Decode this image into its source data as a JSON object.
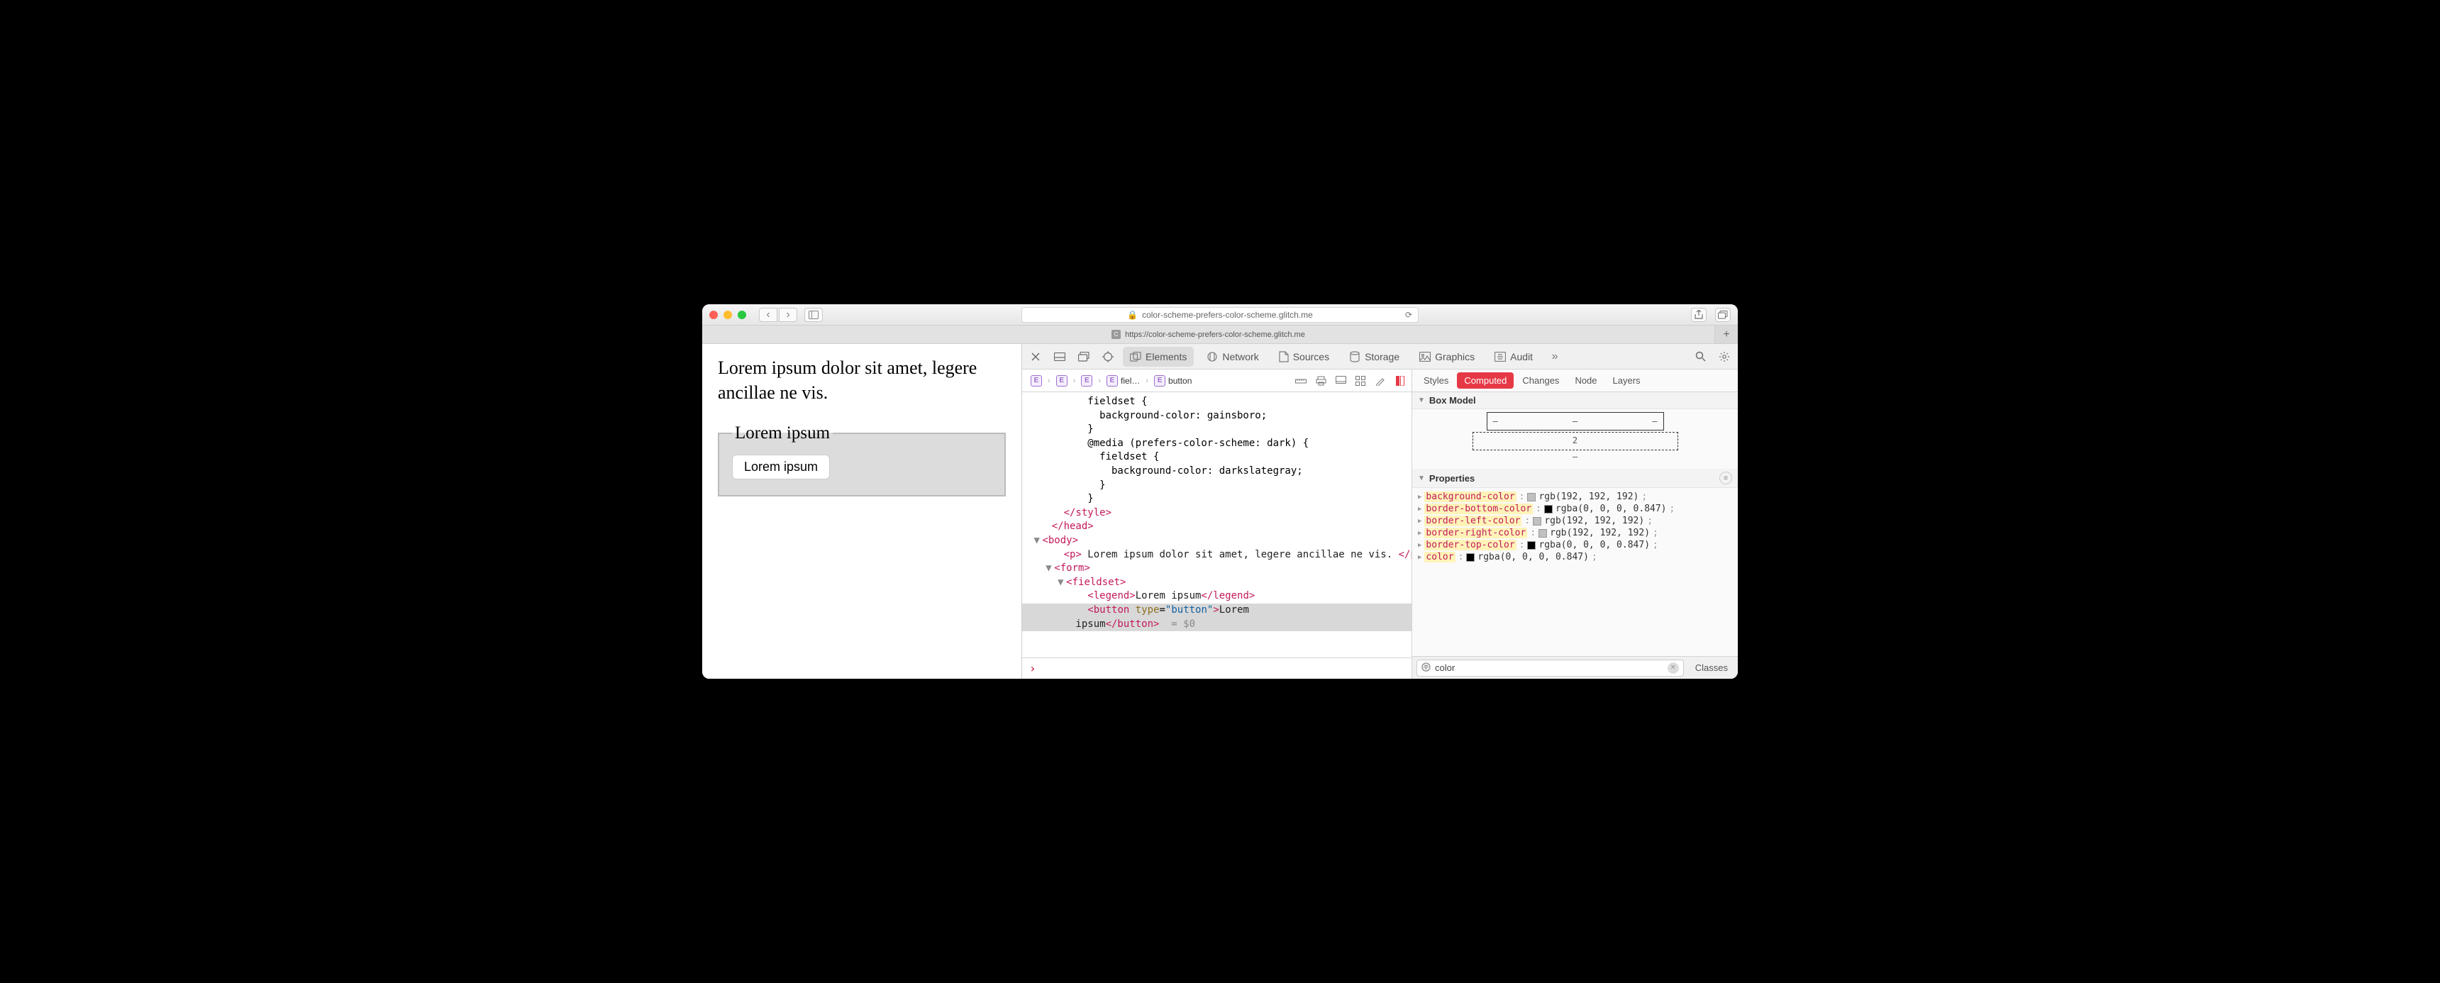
{
  "window": {
    "address": "color-scheme-prefers-color-scheme.glitch.me",
    "tab_title": "https://color-scheme-prefers-color-scheme.glitch.me"
  },
  "page": {
    "paragraph": "Lorem ipsum dolor sit amet, legere ancillae ne vis.",
    "legend": "Lorem ipsum",
    "button": "Lorem ipsum"
  },
  "devtools": {
    "tabs": {
      "elements": "Elements",
      "network": "Network",
      "sources": "Sources",
      "storage": "Storage",
      "graphics": "Graphics",
      "audit": "Audit"
    },
    "breadcrumb": {
      "fieldset_abbr": "fiel…",
      "button": "button"
    },
    "dom": {
      "l1": "          fieldset {",
      "l2": "            background-color: gainsboro;",
      "l3": "          }",
      "l4": "          @media (prefers-color-scheme: dark) {",
      "l5": "            fieldset {",
      "l6": "              background-color: darkslategray;",
      "l7": "            }",
      "l8": "          }",
      "p_text": " Lorem ipsum dolor sit amet, legere ancillae ne vis. ",
      "legend_text": "Lorem ipsum",
      "btn_text_a": "Lorem",
      "btn_text_b": "        ipsum",
      "ref": "= $0"
    },
    "styles": {
      "tabs": {
        "styles": "Styles",
        "computed": "Computed",
        "changes": "Changes",
        "node": "Node",
        "layers": "Layers"
      },
      "box_model_label": "Box Model",
      "box_model_margin": "2",
      "properties_label": "Properties",
      "props": [
        {
          "name": "background-color",
          "swatch": "#c0c0c0",
          "value": "rgb(192, 192, 192)"
        },
        {
          "name": "border-bottom-color",
          "swatch": "#000000",
          "value": "rgba(0, 0, 0, 0.847)"
        },
        {
          "name": "border-left-color",
          "swatch": "#c0c0c0",
          "value": "rgb(192, 192, 192)"
        },
        {
          "name": "border-right-color",
          "swatch": "#c0c0c0",
          "value": "rgb(192, 192, 192)"
        },
        {
          "name": "border-top-color",
          "swatch": "#000000",
          "value": "rgba(0, 0, 0, 0.847)"
        },
        {
          "name": "color",
          "swatch": "#000000",
          "value": "rgba(0, 0, 0, 0.847)"
        }
      ],
      "filter_value": "color",
      "classes_label": "Classes"
    }
  }
}
